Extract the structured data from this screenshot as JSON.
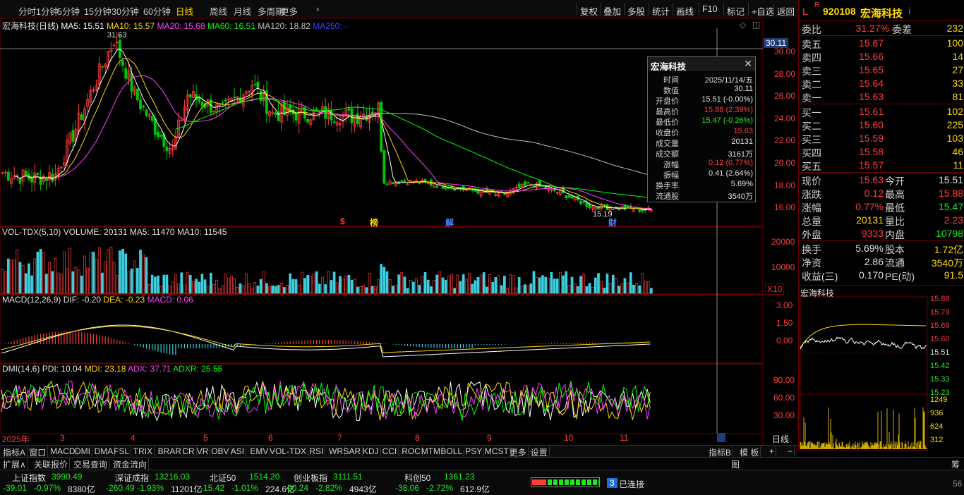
{
  "period_tabs": [
    "分时",
    "1分钟",
    "5分钟",
    "15分钟",
    "30分钟",
    "60分钟",
    "日线",
    "周线",
    "月线",
    "多周期",
    "更多"
  ],
  "active_period": "日线",
  "toolbar_right": [
    "复权",
    "叠加",
    "多股",
    "统计",
    "画线",
    "F10",
    "标记",
    "+自选",
    "返回"
  ],
  "stock": {
    "code": "920108",
    "name": "宏海科技",
    "badge": "R",
    "l": "L"
  },
  "main_header": {
    "title": "宏海科技(日线)",
    "ma5": "MA5: 15.51",
    "ma10": "MA10: 15.57",
    "ma20": "MA20: 15.68",
    "ma60": "MA60: 16.51",
    "ma120": "MA120: 18.82",
    "ma250": "MA250: -"
  },
  "price_axis": [
    "30.00",
    "28.00",
    "26.00",
    "24.00",
    "22.00",
    "20.00",
    "18.00",
    "16.00"
  ],
  "crosshair_price": "30.11",
  "annotations": {
    "high": "31.63",
    "low": "15.19",
    "markers": [
      "$",
      "榜",
      "解",
      "财"
    ]
  },
  "vol_header": {
    "name": "VOL-TDX(5,10)",
    "volume": "VOLUME: 20131",
    "ma5": "MA5: 11470",
    "ma10": "MA10: 11545"
  },
  "vol_axis": [
    "20000",
    "10000"
  ],
  "vol_unit": "X10",
  "macd_header": {
    "name": "MACD(12,26,9)",
    "dif": "DIF: -0.20",
    "dea": "DEA: -0.23",
    "macd": "MACD: 0.06"
  },
  "macd_axis": [
    "3.00",
    "1.50",
    "0.00"
  ],
  "dmi_header": {
    "name": "DMI(14,6)",
    "pdi": "PDI: 10.04",
    "mdi": "MDI: 23.18",
    "adx": "ADX: 37.71",
    "adxr": "ADXR: 25.55"
  },
  "dmi_axis": [
    "90.00",
    "60.00",
    "30.00"
  ],
  "date_labels": [
    "2025年",
    "3",
    "4",
    "5",
    "6",
    "7",
    "8",
    "9",
    "10",
    "11"
  ],
  "timeframe_label": "日线",
  "tooltip": {
    "title": "宏海科技",
    "rows": [
      {
        "k": "时间",
        "v": "2025/11/14/五",
        "c": "#e0e0e0"
      },
      {
        "k": "数值",
        "v": "30.11",
        "c": "#e0e0e0"
      },
      {
        "k": "开盘价",
        "v": "15.51 (-0.00%)",
        "c": "#e0e0e0"
      },
      {
        "k": "最高价",
        "v": "15.88 (2.39%)",
        "c": "#ff3c3c"
      },
      {
        "k": "最低价",
        "v": "15.47 (-0.26%)",
        "c": "#22e622"
      },
      {
        "k": "收盘价",
        "v": "15.63",
        "c": "#ff3c3c"
      },
      {
        "k": "成交量",
        "v": "20131",
        "c": "#e0e0e0"
      },
      {
        "k": "成交额",
        "v": "3161万",
        "c": "#e0e0e0"
      },
      {
        "k": "涨幅",
        "v": "0.12 (0.77%)",
        "c": "#ff3c3c"
      },
      {
        "k": "振幅",
        "v": "0.41 (2.64%)",
        "c": "#e0e0e0"
      },
      {
        "k": "换手率",
        "v": "5.69%",
        "c": "#e0e0e0"
      },
      {
        "k": "流通股",
        "v": "3540万",
        "c": "#e0e0e0"
      }
    ]
  },
  "order_book": {
    "weibi": {
      "label": "委比",
      "pct": "31.27%",
      "diff_label": "委差",
      "diff": "232"
    },
    "asks": [
      {
        "label": "卖五",
        "price": "15.67",
        "vol": "100"
      },
      {
        "label": "卖四",
        "price": "15.66",
        "vol": "14"
      },
      {
        "label": "卖三",
        "price": "15.65",
        "vol": "27"
      },
      {
        "label": "卖二",
        "price": "15.64",
        "vol": "33"
      },
      {
        "label": "卖一",
        "price": "15.63",
        "vol": "81"
      }
    ],
    "bids": [
      {
        "label": "买一",
        "price": "15.61",
        "vol": "102"
      },
      {
        "label": "买二",
        "price": "15.60",
        "vol": "225"
      },
      {
        "label": "买三",
        "price": "15.59",
        "vol": "103"
      },
      {
        "label": "买四",
        "price": "15.58",
        "vol": "46"
      },
      {
        "label": "买五",
        "price": "15.57",
        "vol": "11"
      }
    ]
  },
  "quote": [
    {
      "k1": "现价",
      "v1": "15.63",
      "c1": "#ff3c3c",
      "k2": "今开",
      "v2": "15.51",
      "c2": "#e0e0e0"
    },
    {
      "k1": "涨跌",
      "v1": "0.12",
      "c1": "#ff3c3c",
      "k2": "最高",
      "v2": "15.88",
      "c2": "#ff3c3c"
    },
    {
      "k1": "涨幅",
      "v1": "0.77%",
      "c1": "#ff3c3c",
      "k2": "最低",
      "v2": "15.47",
      "c2": "#22e622"
    },
    {
      "k1": "总量",
      "v1": "20131",
      "c1": "#ffd700",
      "k2": "量比",
      "v2": "2.23",
      "c2": "#ff3c3c"
    },
    {
      "k1": "外盘",
      "v1": "9333",
      "c1": "#ff3c3c",
      "k2": "内盘",
      "v2": "10798",
      "c2": "#22e622"
    }
  ],
  "fundamentals": [
    {
      "k1": "换手",
      "v1": "5.69%",
      "k2": "股本",
      "v2": "1.72亿"
    },
    {
      "k1": "净资",
      "v1": "2.86",
      "k2": "流通",
      "v2": "3540万"
    },
    {
      "k1": "收益(三)",
      "v1": "0.170",
      "k2": "PE(动)",
      "v2": "91.5"
    }
  ],
  "mini_chart": {
    "title": "宏海科技",
    "price_labels": [
      "15.88",
      "15.79",
      "15.69",
      "15.60",
      "15.51",
      "15.42",
      "15.33",
      "15.23"
    ],
    "vol_labels": [
      "1249",
      "936",
      "624",
      "312"
    ]
  },
  "bottom_tabs": [
    "指标A",
    "窗口",
    "MACD",
    "DMI",
    "DMA",
    "FSL",
    "TRIX",
    "BRAR",
    "CR",
    "VR",
    "OBV",
    "ASI",
    "EMV",
    "VOL-TDX",
    "RSI",
    "WR",
    "SAR",
    "KDJ",
    "CCI",
    "ROC",
    "MTM",
    "BOLL",
    "PSY",
    "MCST",
    "更多",
    "设置"
  ],
  "bottom_tabs_right": [
    "指标B",
    "模 板",
    "+",
    "−"
  ],
  "bar2_tabs": [
    "扩展∧",
    "关联报价",
    "交易查询",
    "资金流向"
  ],
  "bar2_right": [
    "图",
    "筹"
  ],
  "indices": [
    {
      "name": "上证指数",
      "value": "3990.49",
      "chg": "-39.01",
      "pct": "-0.97%",
      "amt": "8380亿"
    },
    {
      "name": "深证成指",
      "value": "13216.03",
      "chg": "-260.49",
      "pct": "-1.93%",
      "amt": "11201亿"
    },
    {
      "name": "北证50",
      "value": "1514.20",
      "chg": "-15.42",
      "pct": "-1.01%",
      "amt": "224.6亿"
    },
    {
      "name": "创业板指",
      "value": "3111.51",
      "chg": "-90.24",
      "pct": "-2.82%",
      "amt": "4943亿"
    },
    {
      "name": "科创50",
      "value": "1361.23",
      "chg": "-38.06",
      "pct": "-2.72%",
      "amt": "612.9亿"
    }
  ],
  "connection": {
    "count": "3",
    "text": "已连接"
  },
  "colors": {
    "up": "#ff3c3c",
    "down": "#22e622",
    "accent": "#ffd700",
    "ma5": "#ffffff",
    "ma10": "#ffd700",
    "ma20": "#ff40ff",
    "ma60": "#00ff00",
    "ma120": "#c0c0c0",
    "ma250": "#4040ff"
  }
}
